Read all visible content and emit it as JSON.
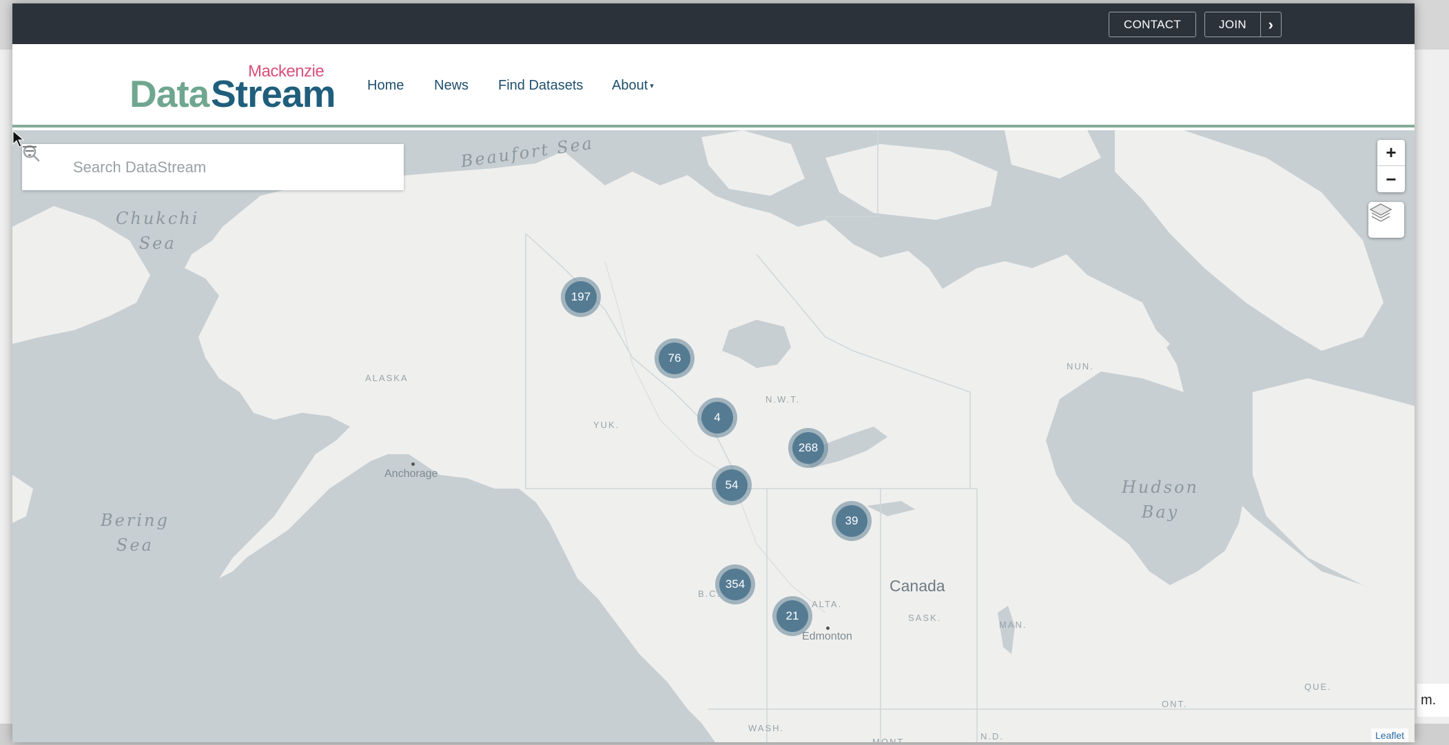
{
  "utility_bar": {
    "contact_label": "CONTACT",
    "join_label": "JOIN",
    "join_arrow": "›"
  },
  "header": {
    "logo": {
      "small": "Mackenzie",
      "part1": "Data",
      "part2": "Stream"
    },
    "nav": {
      "home": "Home",
      "news": "News",
      "find_datasets": "Find Datasets",
      "about": "About",
      "about_caret": "▾"
    }
  },
  "search": {
    "placeholder": "Search DataStream"
  },
  "map": {
    "zoom_in": "+",
    "zoom_out": "−",
    "labels": {
      "beaufort_sea": "Beaufort Sea",
      "chukchi_sea": "Chukchi\nSea",
      "bering_sea": "Bering\nSea",
      "hudson_bay": "Hudson\nBay",
      "alaska": "ALASKA",
      "yuk": "YUK.",
      "nwt": "N.W.T.",
      "nun": "NUN.",
      "bc": "B.C.",
      "alta": "ALTA.",
      "sask": "SASK.",
      "man": "MAN.",
      "ont": "ONT.",
      "que": "QUE.",
      "wash": "WASH.",
      "mont": "MONT.",
      "nd": "N.D.",
      "anchorage": "Anchorage",
      "edmonton": "Edmonton",
      "canada": "Canada"
    },
    "clusters": [
      {
        "count": "197"
      },
      {
        "count": "76"
      },
      {
        "count": "4"
      },
      {
        "count": "268"
      },
      {
        "count": "54"
      },
      {
        "count": "39"
      },
      {
        "count": "354"
      },
      {
        "count": "21"
      }
    ],
    "attribution": "Leaflet"
  },
  "background": {
    "side_note": "m."
  },
  "colors": {
    "utility_bar": "#2b323a",
    "brand_green": "#6fa68f",
    "brand_blue": "#1f5e7c",
    "brand_pink": "#d9507a",
    "water": "#c7cfd3",
    "land": "#efefee",
    "cluster": "#557b93"
  }
}
